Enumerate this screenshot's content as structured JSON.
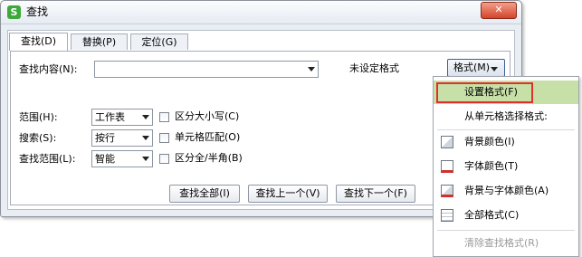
{
  "window": {
    "app_icon_glyph": "S",
    "title": "查找",
    "close_glyph": "✕"
  },
  "tabs": [
    {
      "label": "查找(D)",
      "active": true
    },
    {
      "label": "替换(P)",
      "active": false
    },
    {
      "label": "定位(G)",
      "active": false
    }
  ],
  "find": {
    "label": "查找内容(N):",
    "value": "",
    "format_status": "未设定格式",
    "format_button": "格式(M)"
  },
  "options": {
    "scope_label": "范围(H):",
    "scope_value": "工作表",
    "search_label": "搜索(S):",
    "search_value": "按行",
    "lookin_label": "查找范围(L):",
    "lookin_value": "智能",
    "match_case": "区分大小写(C)",
    "match_cell": "单元格匹配(O)",
    "match_width": "区分全/半角(B)"
  },
  "buttons": {
    "find_all": "查找全部(I)",
    "find_prev": "查找上一个(V)",
    "find_next": "查找下一个(F)"
  },
  "menu": {
    "set_format": "设置格式(F)",
    "from_cell_heading": "从单元格选择格式:",
    "bg_color": "背景颜色(I)",
    "font_color": "字体颜色(T)",
    "bg_font_color": "背景与字体颜色(A)",
    "all_format": "全部格式(C)",
    "clear_format": "清除查找格式(R)"
  },
  "colors": {
    "highlight": "#c7e0a7",
    "highlight_border": "#e0302a",
    "app_icon": "#3fa83b",
    "close_button": "#d3442c"
  }
}
